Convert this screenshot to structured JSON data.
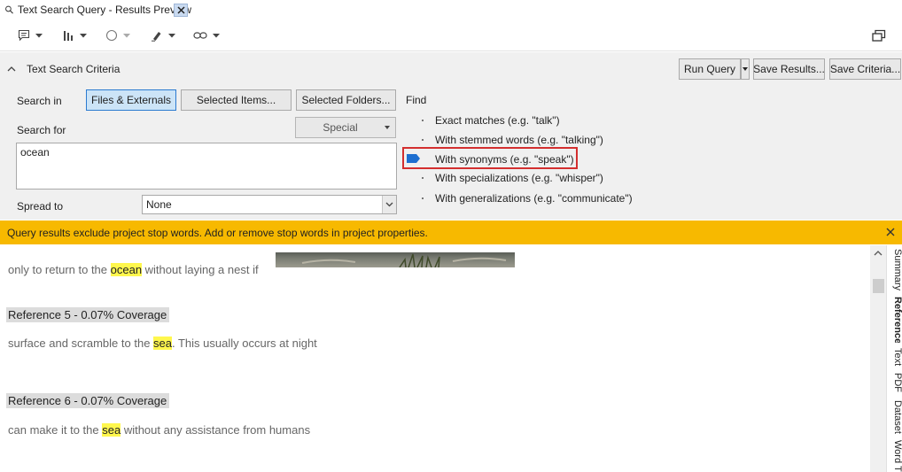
{
  "tab": {
    "title": "Text Search Query - Results Preview",
    "close_symbol": "✕",
    "icon": "magnifier-icon"
  },
  "toolbar": {
    "buttons": [
      {
        "name": "annotation-icon"
      },
      {
        "name": "chart-icon"
      },
      {
        "name": "shape-icon"
      },
      {
        "name": "highlight-icon"
      },
      {
        "name": "link-icon"
      }
    ],
    "restore_icon": "window-restore-icon"
  },
  "criteria": {
    "header": "Text Search Criteria",
    "collapse_icon": "chevron-up-icon",
    "run_query": "Run Query",
    "save_results": "Save Results...",
    "save_criteria": "Save Criteria...",
    "search_in_label": "Search in",
    "scope_buttons": [
      {
        "label": "Files & Externals",
        "active": true
      },
      {
        "label": "Selected Items...",
        "active": false
      },
      {
        "label": "Selected Folders...",
        "active": false
      }
    ],
    "find_label": "Find",
    "search_for_label": "Search for",
    "special_label": "Special",
    "search_value": "ocean",
    "spread_label": "Spread to",
    "spread_value": "None",
    "find_options": [
      {
        "label": "Exact matches (e.g. \"talk\")",
        "selected": false
      },
      {
        "label": "With stemmed words (e.g. \"talking\")",
        "selected": false
      },
      {
        "label": "With synonyms (e.g. \"speak\")",
        "selected": true
      },
      {
        "label": "With specializations (e.g. \"whisper\")",
        "selected": false
      },
      {
        "label": "With generalizations (e.g. \"communicate\")",
        "selected": false
      }
    ],
    "slider_color": "#1e6fd0",
    "highlight_color": "#d32f2f"
  },
  "banner": {
    "message": "Query results exclude project stop words. Add or remove stop words in project properties.",
    "color": "#f7b900",
    "close_symbol": "✕"
  },
  "preview": {
    "line1": {
      "before": "only to return to the ",
      "match": "ocean",
      "after": " without laying a nest if"
    },
    "ref5": "Reference 5 - 0.07% Coverage",
    "line2": {
      "before": "surface and scramble to the ",
      "match": "sea",
      "after": ". This usually occurs at night"
    },
    "ref6": "Reference 6 - 0.07% Coverage",
    "line3": {
      "before": "can make it to the ",
      "match": "sea",
      "after": " without any assistance from humans"
    },
    "highlight_color": "#fff74d"
  },
  "side_tabs": [
    {
      "label": "Summary",
      "selected": false
    },
    {
      "label": "Reference",
      "selected": true
    },
    {
      "label": "Text",
      "selected": false
    },
    {
      "label": "PDF",
      "selected": false
    },
    {
      "label": "Dataset",
      "selected": false
    },
    {
      "label": "Word Tree",
      "selected": false
    }
  ]
}
